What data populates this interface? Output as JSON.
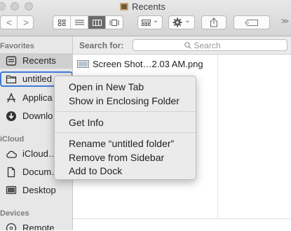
{
  "window": {
    "title": "Recents",
    "icons": {
      "close": "traffic-close",
      "minimize": "traffic-minimize",
      "zoom": "traffic-zoom",
      "title": "recents-folder-icon"
    }
  },
  "toolbar": {
    "back_glyph": "<",
    "forward_glyph": ">",
    "view_modes": [
      "icon-view",
      "list-view",
      "column-view",
      "gallery-view"
    ],
    "active_view": "column-view",
    "group_dropdown_glyph": "⌄",
    "action_dropdown_glyph": "⌄",
    "overflow_glyph": ">>"
  },
  "sidebar": {
    "sections": [
      {
        "heading": "Favorites"
      },
      {
        "heading": "iCloud"
      },
      {
        "heading": "Devices"
      }
    ],
    "favorites": [
      {
        "label": "Recents",
        "icon": "recents-icon",
        "selected": true
      },
      {
        "label": "untitled",
        "icon": "folder-icon",
        "context_target": true
      },
      {
        "label": "Applica",
        "icon": "applications-icon"
      },
      {
        "label": "Downlo",
        "icon": "downloads-icon"
      }
    ],
    "icloud": [
      {
        "label": "iCloud…",
        "icon": "icloud-drive-icon"
      },
      {
        "label": "Docum…",
        "icon": "documents-icon"
      },
      {
        "label": "Desktop",
        "icon": "desktop-icon"
      }
    ],
    "devices": [
      {
        "label": "Remote",
        "icon": "remote-disc-icon"
      }
    ]
  },
  "search": {
    "label": "Search for:",
    "placeholder": "Search"
  },
  "files": [
    {
      "name": "Screen Shot…2.03 AM.png",
      "icon": "image-file-icon"
    }
  ],
  "context_menu": {
    "groups": [
      [
        "Open in New Tab",
        "Show in Enclosing Folder"
      ],
      [
        "Get Info"
      ],
      [
        "Rename “untitled folder”",
        "Remove from Sidebar",
        "Add to Dock"
      ]
    ]
  },
  "colors": {
    "sidebar_bg": "#e8e7e8",
    "selected_row": "#d0cfd0",
    "focus_ring": "#3d7bd8",
    "menu_bg": "#ecebec"
  }
}
